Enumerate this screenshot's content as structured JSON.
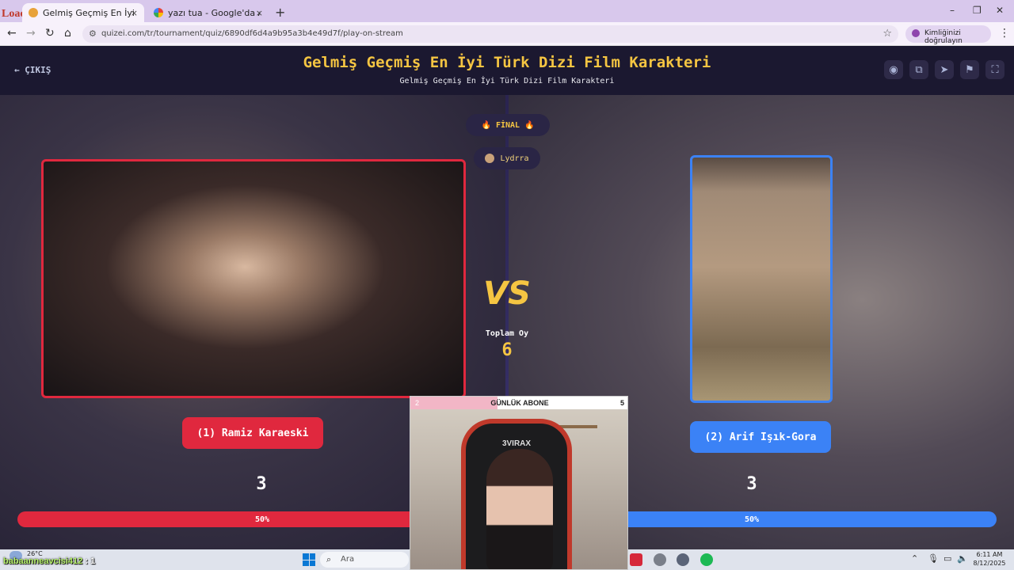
{
  "browser": {
    "loading_text": "Loading...",
    "tabs": [
      {
        "label": "Gelmiş Geçmiş En İyi Türk Dizi F",
        "close": "×",
        "active": true
      },
      {
        "label": "yazı tua - Google'da Ara",
        "close": "×",
        "active": false
      }
    ],
    "new_tab": "+",
    "window_controls": [
      "–",
      "❐",
      "✕"
    ],
    "url": "quizei.com/tr/tournament/quiz/6890df6d4a9b95a3b4e49d7f/play-on-stream",
    "verify_label": "Kimliğinizi doğrulayın",
    "nav": {
      "back": "←",
      "forward": "→",
      "reload": "↻",
      "home": "⌂",
      "menu": "⋮",
      "star": "☆",
      "site_info": "⚙"
    }
  },
  "page": {
    "exit_label": "← ÇIKIŞ",
    "title": "Gelmiş Geçmiş En İyi Türk Dizi Film Karakteri",
    "subtitle": "Gelmiş Geçmiş En İyi Türk Dizi Film Karakteri",
    "header_icons": [
      "eye-icon",
      "copy-icon",
      "send-icon",
      "flag-icon",
      "fullscreen-icon"
    ],
    "round_label": "🔥 FİNAL 🔥",
    "host_name": "Lydrra",
    "vs_label": "VS",
    "total_votes_label": "Toplam Oy",
    "total_votes": "6",
    "accent_colors": {
      "left": "#e0283e",
      "right": "#3b82f6",
      "gold": "#f5c542"
    }
  },
  "contestants": [
    {
      "label": "(1) Ramiz Karaeski",
      "votes": "3",
      "percent_label": "50%",
      "percent": 50
    },
    {
      "label": "(2) Arif Işık-Gora",
      "votes": "3",
      "percent_label": "50%",
      "percent": 50
    }
  ],
  "stream_overlay": {
    "sub_goal_left": "2",
    "sub_goal_title": "GÜNLÜK ABONE",
    "sub_goal_right": "5",
    "sub_goal_progress": 0.4,
    "chair_brand": "3VIRAX"
  },
  "chat": {
    "user": "babaanneavcisi412",
    "message": ": 1"
  },
  "taskbar": {
    "temperature": "26°C",
    "search_placeholder": "Ara",
    "time": "6:11 AM",
    "date": "8/12/2025"
  }
}
